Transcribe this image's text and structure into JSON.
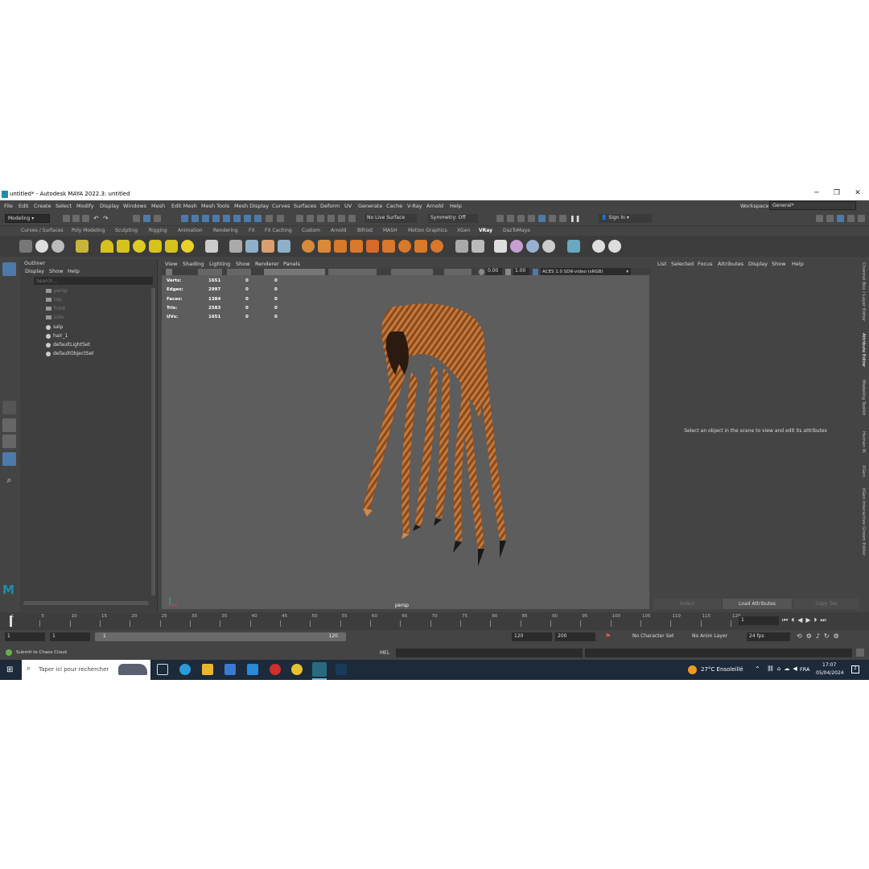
{
  "window": {
    "title": "untitled* - Autodesk MAYA 2022.3: untitled",
    "controls": {
      "minimize": "─",
      "restore": "❐",
      "close": "✕"
    }
  },
  "menubar": {
    "items": [
      "File",
      "Edit",
      "Create",
      "Select",
      "Modify",
      "Display",
      "Windows",
      "Mesh",
      "Edit Mesh",
      "Mesh Tools",
      "Mesh Display",
      "Curves",
      "Surfaces",
      "Deform",
      "UV",
      "Generate",
      "Cache",
      "V-Ray",
      "Arnold",
      "Help"
    ],
    "workspace_label": "Workspace:",
    "workspace_value": "General*"
  },
  "statusline": {
    "mode": "Modeling",
    "live_surface": "No Live Surface",
    "symmetry": "Symmetry: Off",
    "sign_in": "Sign In"
  },
  "shelf": {
    "tabs": [
      "Curves / Surfaces",
      "Poly Modeling",
      "Sculpting",
      "Rigging",
      "Animation",
      "Rendering",
      "FX",
      "FX Caching",
      "Custom",
      "Arnold",
      "Bifrost",
      "MASH",
      "Motion Graphics",
      "XGen",
      "VRay",
      "DazToMaya"
    ],
    "active_tab": "VRay"
  },
  "outliner": {
    "title": "Outliner",
    "menu": [
      "Display",
      "Show",
      "Help"
    ],
    "search_placeholder": "Search...",
    "items": [
      {
        "label": "persp",
        "icon": "camera-icon",
        "dim": true
      },
      {
        "label": "top",
        "icon": "camera-icon",
        "dim": true
      },
      {
        "label": "front",
        "icon": "camera-icon",
        "dim": true
      },
      {
        "label": "side",
        "icon": "camera-icon",
        "dim": true
      },
      {
        "label": "salp",
        "icon": "transform-icon",
        "dim": false
      },
      {
        "label": "hair_1",
        "icon": "transform-icon",
        "dim": false
      },
      {
        "label": "defaultLightSet",
        "icon": "set-icon",
        "dim": false
      },
      {
        "label": "defaultObjectSet",
        "icon": "set-icon",
        "dim": false
      }
    ]
  },
  "viewport": {
    "menu": [
      "View",
      "Shading",
      "Lighting",
      "Show",
      "Renderer",
      "Panels"
    ],
    "exposure": "0.00",
    "gamma": "1.00",
    "color_space": "ACES 1.0 SDR-video (sRGB)",
    "camera_label": "persp",
    "hud": [
      {
        "label": "Verts:",
        "values": [
          "1651",
          "0",
          "0"
        ]
      },
      {
        "label": "Edges:",
        "values": [
          "2997",
          "0",
          "0"
        ]
      },
      {
        "label": "Faces:",
        "values": [
          "1384",
          "0",
          "0"
        ]
      },
      {
        "label": "Tris:",
        "values": [
          "2583",
          "0",
          "0"
        ]
      },
      {
        "label": "UVs:",
        "values": [
          "1651",
          "0",
          "0"
        ]
      }
    ]
  },
  "attribute_editor": {
    "menu": [
      "List",
      "Selected",
      "Focus",
      "Attributes",
      "Display",
      "Show",
      "Help"
    ],
    "message": "Select an object in the scene to view and edit its attributes",
    "buttons": [
      "Select",
      "Load Attributes",
      "Copy Tab"
    ]
  },
  "side_tabs": [
    "Channel Box / Layer Editor",
    "Attribute Editor",
    "Modeling Toolkit",
    "Human IK",
    "XGen",
    "XGen Interactive Groom Editor"
  ],
  "timeslider": {
    "ticks": [
      "1",
      "5",
      "10",
      "15",
      "20",
      "25",
      "30",
      "35",
      "40",
      "45",
      "50",
      "55",
      "60",
      "65",
      "70",
      "75",
      "80",
      "85",
      "90",
      "95",
      "100",
      "105",
      "110",
      "115",
      "120"
    ],
    "current_frame": "1"
  },
  "range": {
    "start": "1",
    "playback_start": "1",
    "slider_start": "1",
    "slider_end": "120",
    "playback_end": "120",
    "end": "200",
    "character_set": "No Character Set",
    "anim_layer": "No Anim Layer",
    "fps": "24 fps"
  },
  "cmdline": {
    "help_text": "Submit to Chaos Cloud",
    "lang": "MEL"
  },
  "taskbar": {
    "search_placeholder": "Taper ici pour rechercher",
    "weather": "27°C  Ensoleillé",
    "language": "FRA",
    "time": "17:07",
    "date": "05/04/2024",
    "notifications": "2"
  },
  "colors": {
    "accent": "#4d7aa8",
    "hair_orange": "#b5682c",
    "maya_teal": "#1e8fa8"
  }
}
